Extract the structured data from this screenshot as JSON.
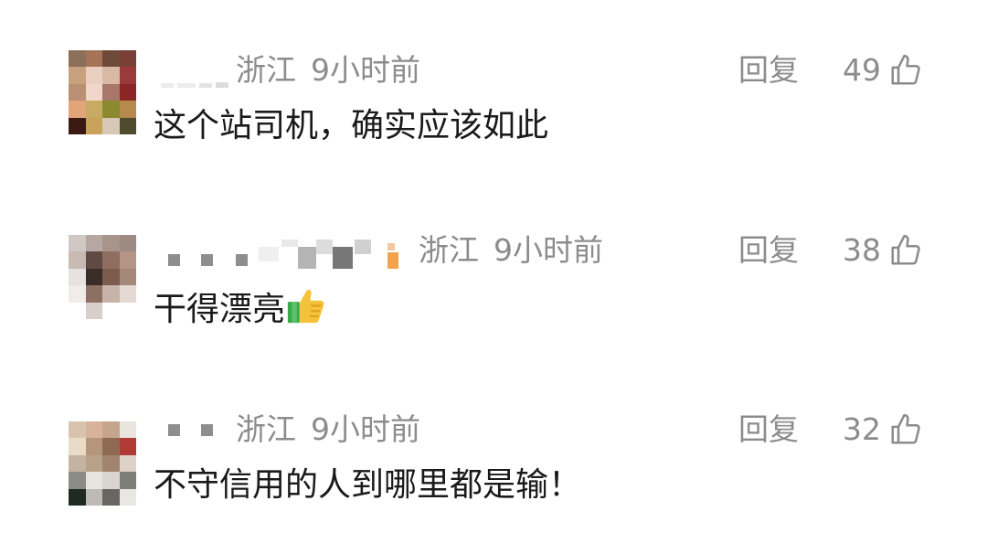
{
  "comments": [
    {
      "region": "浙江",
      "time": "9小时前",
      "reply_label": "回复",
      "likes": "49",
      "text": "这个站司机，确实应该如此",
      "avatar_colors": [
        "#8b6f58",
        "#a57457",
        "#6e4a3a",
        "#7a3f37",
        "#c7a17e",
        "#e8cfc0",
        "#d8b9a6",
        "#9a3b3b",
        "#b99073",
        "#f0d7c9",
        "#a8766a",
        "#8a2626",
        "#e2a57a",
        "#c9aa63",
        "#8b8a2f",
        "#b58a4c",
        "#3a1a12",
        "#c8a15a",
        "#d7c8b8",
        "#4e4a2b"
      ]
    },
    {
      "region": "浙江",
      "time": "9小时前",
      "reply_label": "回复",
      "likes": "38",
      "text": "干得漂亮",
      "avatar_colors": [
        "#cfc8c5",
        "#b7a7a2",
        "#a9948c",
        "#9d8a83",
        "#c9b9b3",
        "#5f4b43",
        "#8f6e5f",
        "#b49585",
        "#e7e2e0",
        "#3a2c27",
        "#7b5c4f",
        "#a48878",
        "#f1ecea",
        "#8e7063",
        "#c8b3a8",
        "#e4d9d3",
        "#ffffff",
        "#d9cec9",
        "#ffffff",
        "#ffffff"
      ]
    },
    {
      "region": "浙江",
      "time": "9小时前",
      "reply_label": "回复",
      "likes": "32",
      "text": "不守信用的人到哪里都是输！",
      "avatar_colors": [
        "#d8c3ae",
        "#d7b39a",
        "#c6a58d",
        "#e8e4de",
        "#e8dcc9",
        "#b5967d",
        "#8e6a55",
        "#b23a36",
        "#c4b3a0",
        "#b9a188",
        "#a0846d",
        "#ddd2c7",
        "#8a8a86",
        "#e8e5e0",
        "#d9d5d0",
        "#7d7d7a",
        "#1f2a22",
        "#bdb9b4",
        "#676663",
        "#e9e7e4"
      ]
    }
  ],
  "colors": {
    "meta_gray": "#8c8c8c",
    "text_dark": "#1a1a1a"
  },
  "icons": {
    "like": "thumbs-up-outline-icon",
    "emoji": "thumbs-up-emoji-icon"
  }
}
